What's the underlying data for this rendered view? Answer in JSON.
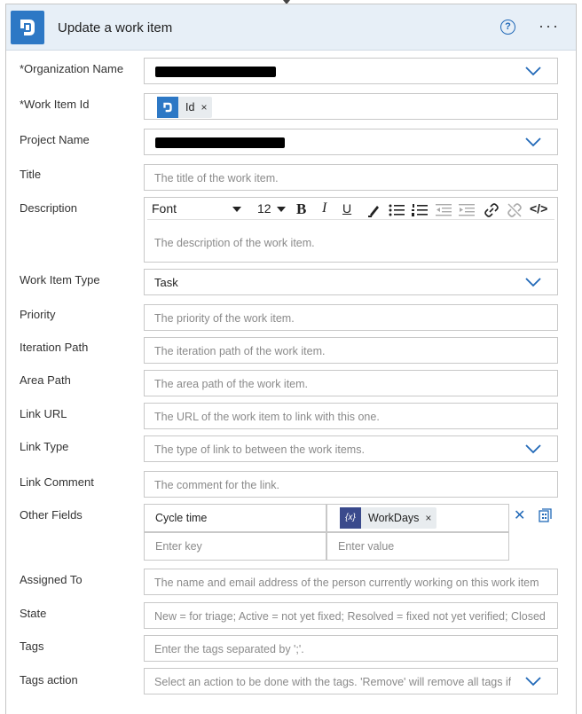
{
  "header": {
    "title": "Update a work item",
    "help_glyph": "?",
    "more_glyph": "···",
    "icon": "azure-devops-icon"
  },
  "fields": {
    "organization_name": {
      "label": "*Organization Name",
      "value_redacted": true
    },
    "work_item_id": {
      "label": "*Work Item Id",
      "token": "Id",
      "token_remove": "×"
    },
    "project_name": {
      "label": "Project Name",
      "value_redacted": true
    },
    "title": {
      "label": "Title",
      "placeholder": "The title of the work item."
    },
    "description": {
      "label": "Description",
      "placeholder": "The description of the work item.",
      "toolbar": {
        "font": "Font",
        "size": "12",
        "bold": "B",
        "italic": "I",
        "underline": "U",
        "code": "</>"
      }
    },
    "work_item_type": {
      "label": "Work Item Type",
      "value": "Task"
    },
    "priority": {
      "label": "Priority",
      "placeholder": "The priority of the work item."
    },
    "iteration_path": {
      "label": "Iteration Path",
      "placeholder": "The iteration path of the work item."
    },
    "area_path": {
      "label": "Area Path",
      "placeholder": "The area path of the work item."
    },
    "link_url": {
      "label": "Link URL",
      "placeholder": "The URL of the work item to link with this one."
    },
    "link_type": {
      "label": "Link Type",
      "placeholder": "The type of link to between the work items."
    },
    "link_comment": {
      "label": "Link Comment",
      "placeholder": "The comment for the link."
    },
    "other_fields": {
      "label": "Other Fields",
      "key_value": "Cycle time",
      "value_token": "WorkDays",
      "value_token_icon": "{x}",
      "token_remove": "×",
      "key_placeholder": "Enter key",
      "value_placeholder": "Enter value",
      "remove_glyph": "✕"
    },
    "assigned_to": {
      "label": "Assigned To",
      "placeholder": "The name and email address of the person currently working on this work item"
    },
    "state": {
      "label": "State",
      "placeholder": "New = for triage; Active = not yet fixed; Resolved = fixed not yet verified; Closed"
    },
    "tags": {
      "label": "Tags",
      "placeholder": "Enter the tags separated by ';'."
    },
    "tags_action": {
      "label": "Tags action",
      "placeholder": "Select an action to be done with the tags. 'Remove' will remove all tags if"
    }
  },
  "colors": {
    "accent": "#2d78c5",
    "header_bg": "#e7eff7",
    "chevron": "#2169b8"
  }
}
